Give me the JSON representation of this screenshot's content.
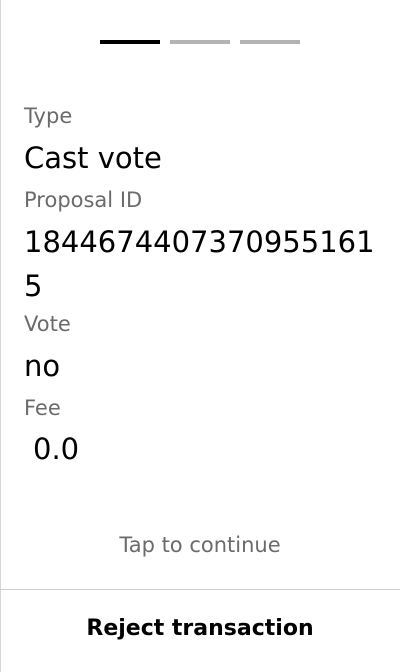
{
  "progress": {
    "total_steps": 3,
    "current_step": 1
  },
  "fields": [
    {
      "label": "Type",
      "value": "Cast vote"
    },
    {
      "label": "Proposal ID",
      "value": "18446744073709551615"
    },
    {
      "label": "Vote",
      "value": "no"
    },
    {
      "label": "Fee",
      "value": "0.0"
    }
  ],
  "tap_to_continue": "Tap to continue",
  "reject_button": "Reject transaction",
  "colors": {
    "active_step": "#000000",
    "inactive_step": "#b3b3b3",
    "label_text": "#6b6b6b"
  }
}
